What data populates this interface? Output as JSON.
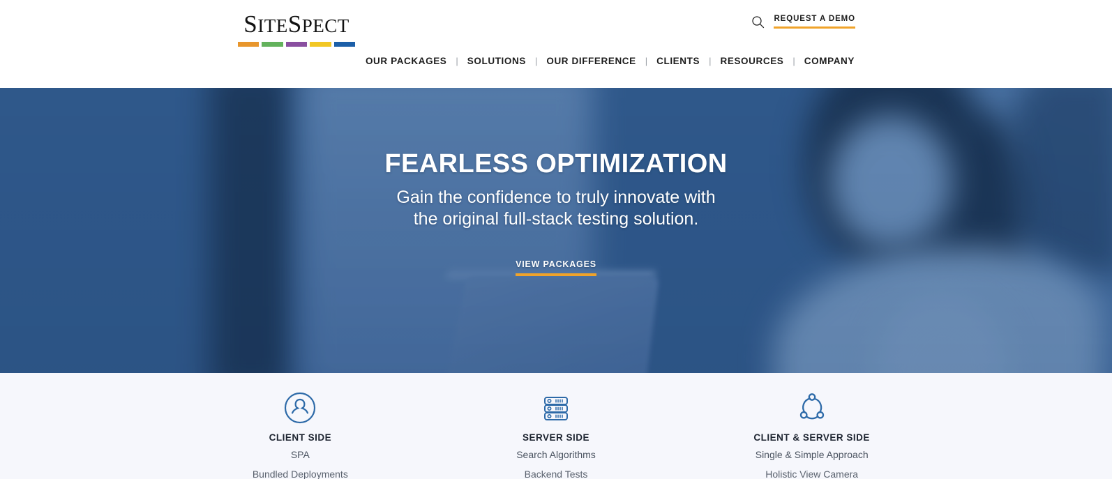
{
  "header": {
    "logo": {
      "part1": "S",
      "part2": "ITE",
      "part3": "S",
      "part4": "PECT",
      "alt": "SiteSpect"
    },
    "logo_bar_colors": [
      "#e8962c",
      "#63b25c",
      "#8a4fa0",
      "#f2c724",
      "#1c5fa8"
    ],
    "search_icon": "search-icon",
    "demo_label": "REQUEST A DEMO",
    "nav": [
      {
        "label": "OUR PACKAGES"
      },
      {
        "label": "SOLUTIONS"
      },
      {
        "label": "OUR DIFFERENCE"
      },
      {
        "label": "CLIENTS"
      },
      {
        "label": "RESOURCES"
      },
      {
        "label": "COMPANY"
      }
    ],
    "nav_separator": "|"
  },
  "hero": {
    "title": "FEARLESS OPTIMIZATION",
    "subtitle_line1": "Gain the confidence to truly innovate with",
    "subtitle_line2": "the original full-stack testing solution.",
    "cta_label": "VIEW PACKAGES",
    "accent_color": "#f0a32a"
  },
  "features": {
    "items": [
      {
        "icon": "user-circle-icon",
        "title": "CLIENT SIDE",
        "line1": "SPA",
        "line2": "Bundled Deployments"
      },
      {
        "icon": "server-rack-icon",
        "title": "SERVER SIDE",
        "line1": "Search Algorithms",
        "line2": "Backend Tests"
      },
      {
        "icon": "network-nodes-icon",
        "title": "CLIENT & SERVER SIDE",
        "line1": "Single & Simple Approach",
        "line2": "Holistic View Camera"
      }
    ],
    "icon_color": "#2d6aa8"
  }
}
